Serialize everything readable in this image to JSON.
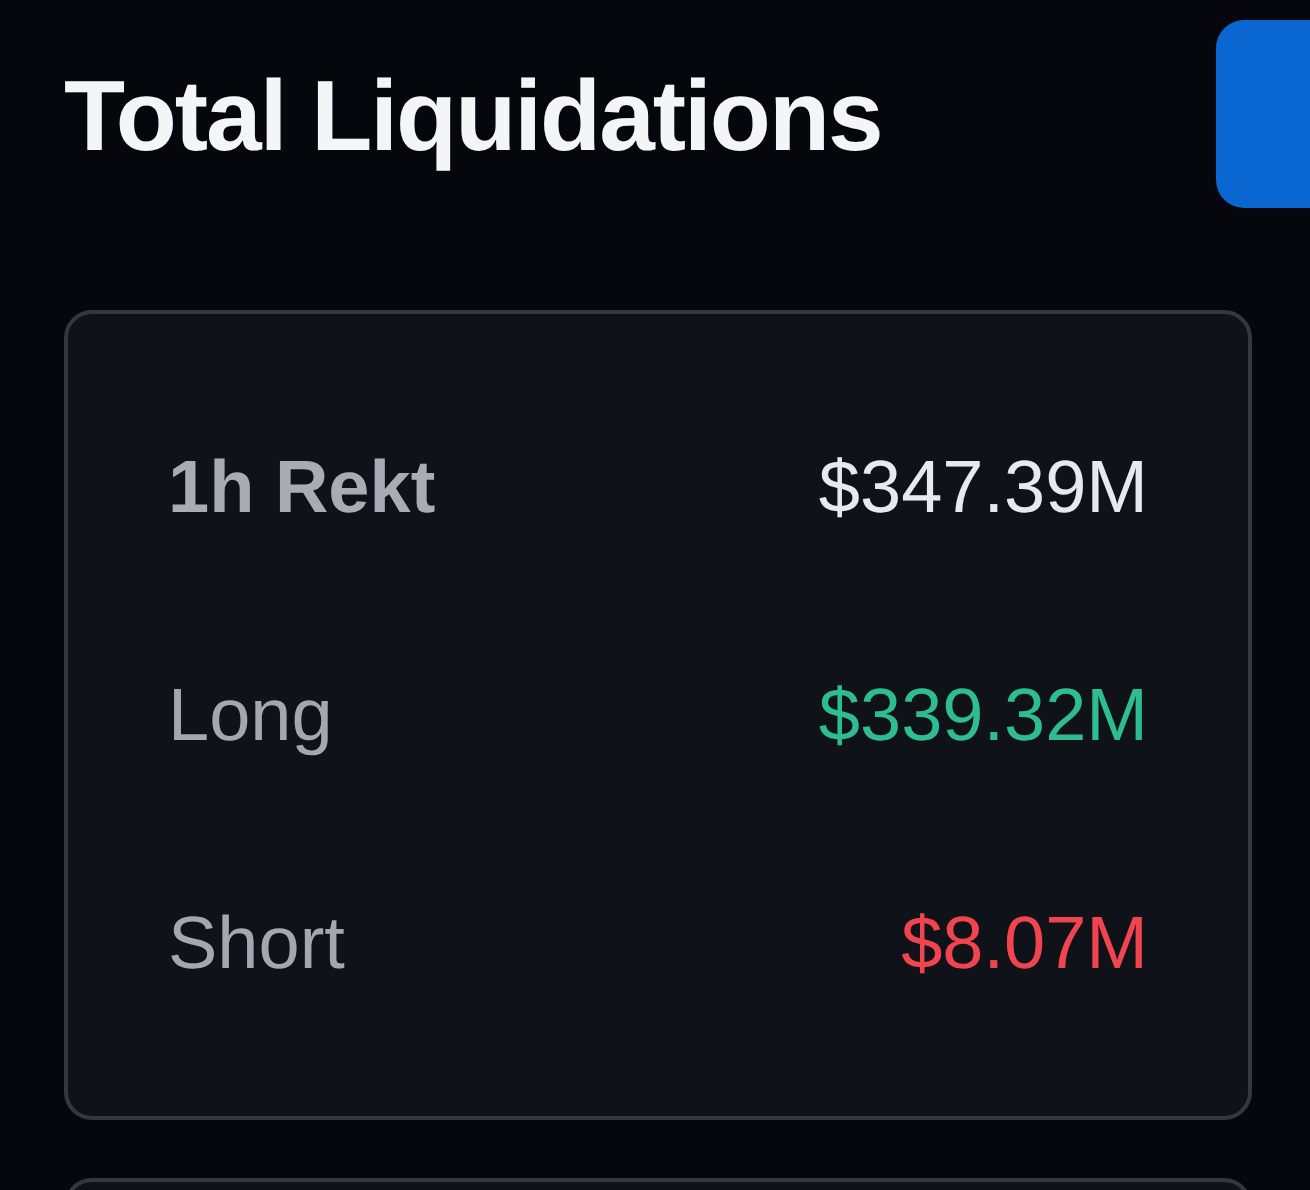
{
  "title": "Total Liquidations",
  "rows": [
    {
      "kind": "total",
      "label": "1h Rekt",
      "value": "$347.39M",
      "color": "#e8e9ec"
    },
    {
      "kind": "side",
      "label": "Long",
      "value": "$339.32M",
      "color": "#2ebd8f"
    },
    {
      "kind": "side",
      "label": "Short",
      "value": "$8.07M",
      "color": "#f0454f"
    }
  ]
}
